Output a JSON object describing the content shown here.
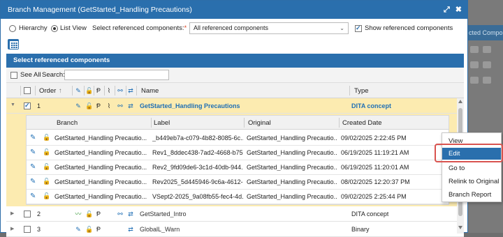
{
  "dialog": {
    "title": "Branch Management (GetStarted_Handling Precautions)",
    "expand_icon": "⤢",
    "close_icon": "✖"
  },
  "background": {
    "partial_label": "cted Compo"
  },
  "view_options": {
    "hierarchy_label": "Hierarchy",
    "listview_label": "List View",
    "selected_view": "List View",
    "select_components_label": "Select referenced components:",
    "required_mark": "*",
    "components_value": "All referenced components",
    "show_referenced_label": "Show referenced components",
    "show_referenced_checked": true
  },
  "panel": {
    "title": "Select referenced components",
    "see_all_label": "See All",
    "search_label": "Search:",
    "search_value": ""
  },
  "columns": {
    "order": "Order",
    "sort_icon": "↑",
    "name": "Name",
    "type": "Type"
  },
  "rows": [
    {
      "order": "1",
      "name": "GetStarted_Handling Precautions",
      "type": "DITA concept",
      "checked": true,
      "expanded": true
    },
    {
      "order": "2",
      "name": "GetStarted_Intro",
      "type": "DITA concept",
      "checked": false,
      "expanded": false
    },
    {
      "order": "3",
      "name": "GlobalL_Warn",
      "type": "Binary",
      "checked": false,
      "expanded": false
    }
  ],
  "branches": {
    "columns": {
      "branch": "Branch",
      "label": "Label",
      "original": "Original",
      "created": "Created Date"
    },
    "items": [
      {
        "branch": "GetStarted_Handling Precautio...",
        "label": "_b449eb7a-c079-4b82-8085-6c...",
        "original": "GetStarted_Handling Precautio...",
        "created": "09/02/2025 2:22:45 PM"
      },
      {
        "branch": "GetStarted_Handling Precautio...",
        "label": "Rev1_8ddec438-7ad2-4668-b75...",
        "original": "GetStarted_Handling Precautio...",
        "created": "06/19/2025 11:19:21 AM"
      },
      {
        "branch": "GetStarted_Handling Precautio...",
        "label": "Rev2_9fd09de6-3c1d-40db-944...",
        "original": "GetStarted_Handling Precautio...",
        "created": "06/19/2025 11:20:01 AM"
      },
      {
        "branch": "GetStarted_Handling Precautio...",
        "label": "Rev2025_5d445946-9c6a-4612-...",
        "original": "GetStarted_Handling Precautio...",
        "created": "08/02/2025 12:20:37 PM"
      },
      {
        "branch": "GetStarted_Handling Precautio...",
        "label": "VSept2-2025_9a08fb55-fec4-4d...",
        "original": "GetStarted_Handling Precautio...",
        "created": "09/02/2025 2:25:44 PM"
      }
    ]
  },
  "context_menu": {
    "items": [
      "View",
      "Edit",
      "Go to",
      "Relink to Original",
      "Branch Report"
    ],
    "highlighted": "Edit"
  },
  "colors": {
    "accent": "#2a6fad",
    "selected_row": "#fcebb0",
    "focus_ring": "#d9534f"
  }
}
